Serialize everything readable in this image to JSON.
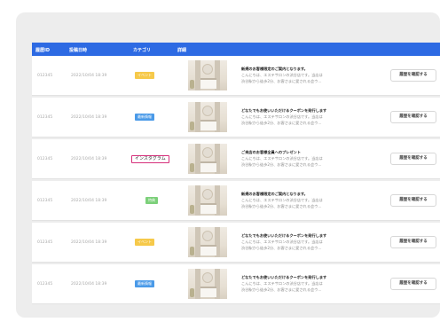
{
  "table": {
    "headers": {
      "id": "履歴ID",
      "date": "投稿日時",
      "category": "カテゴリ",
      "detail": "詳細"
    },
    "rows": [
      {
        "id": "012345",
        "date": "2022/10/04 18:39",
        "category": "イベント",
        "category_color": "#f6c94a",
        "category_style": "fill",
        "title": "新規のお客様限定のご案内となります。",
        "body1": "こんにちは、エステサロンの渋谷店です。当店は",
        "body2": "渋谷駅から徒歩2分、お客さまに愛される会ウ...",
        "button": "履歴を確認する"
      },
      {
        "id": "012345",
        "date": "2022/10/04 18:39",
        "category": "最新情報",
        "category_color": "#4a9ae8",
        "category_style": "fill",
        "title": "どなたでもお使いいただけるクーポンを発行します",
        "body1": "こんにちは、エステサロンの渋谷店です。当店は",
        "body2": "渋谷駅から徒歩2分、お客さまに愛される会ウ...",
        "button": "履歴を確認する"
      },
      {
        "id": "012345",
        "date": "2022/10/04 18:39",
        "category": "インスタグラム",
        "category_color": "#d62f7b",
        "category_style": "outline",
        "title": "ご来店のお客様全員へのプレゼント",
        "body1": "こんにちは、エステサロンの渋谷店です。当店は",
        "body2": "渋谷駅から徒歩2分、お客さまに愛される会ウ...",
        "button": "履歴を確認する"
      },
      {
        "id": "012345",
        "date": "2022/10/04 18:39",
        "category": "特典",
        "category_color": "#7cd07a",
        "category_style": "fill",
        "title": "新規のお客様限定のご案内となります。",
        "body1": "こんにちは、エステサロンの渋谷店です。当店は",
        "body2": "渋谷駅から徒歩2分、お客さまに愛される会ウ...",
        "button": "履歴を確認する"
      },
      {
        "id": "012345",
        "date": "2022/10/04 18:39",
        "category": "イベント",
        "category_color": "#f6c94a",
        "category_style": "fill",
        "title": "どなたでもお使いいただけるクーポンを発行します",
        "body1": "こんにちは、エステサロンの渋谷店です。当店は",
        "body2": "渋谷駅から徒歩2分、お客さまに愛される会ウ...",
        "button": "履歴を確認する"
      },
      {
        "id": "012345",
        "date": "2022/10/04 18:39",
        "category": "最新情報",
        "category_color": "#4a9ae8",
        "category_style": "fill",
        "title": "どなたでもお使いいただけるクーポンを発行します",
        "body1": "こんにちは、エステサロンの渋谷店です。当店は",
        "body2": "渋谷駅から徒歩2分、お客さまに愛される会ウ...",
        "button": "履歴を確認する"
      }
    ]
  },
  "colors": {
    "header_bg": "#2d6ae3",
    "card_bg": "#ededed"
  }
}
